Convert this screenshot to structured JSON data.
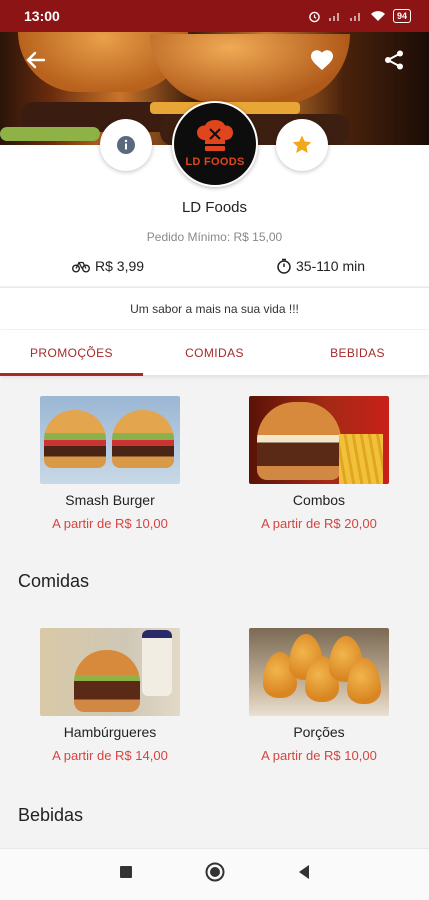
{
  "status_bar": {
    "time": "13:00",
    "battery": "94"
  },
  "colors": {
    "brand": "#8c1414",
    "accent": "#a52a2a",
    "price": "#d64541",
    "favorite_star": "#f0a818"
  },
  "header": {
    "back_icon": "arrow-left-icon",
    "favorite_icon": "heart-icon",
    "share_icon": "share-icon",
    "info_icon": "info-icon",
    "rate_icon": "star-icon",
    "logo_text": "LD FOODS"
  },
  "store": {
    "name": "LD Foods",
    "min_order": "Pedido Mínimo: R$ 15,00",
    "delivery_fee": "R$ 3,99",
    "delivery_time": "35-110 min",
    "slogan": "Um sabor a mais na sua vida !!!"
  },
  "tabs": [
    {
      "label": "PROMOÇÕES",
      "active": true
    },
    {
      "label": "COMIDAS",
      "active": false
    },
    {
      "label": "BEBIDAS",
      "active": false
    }
  ],
  "promotions": [
    {
      "name": "Smash Burger",
      "price": "A partir de R$ 10,00"
    },
    {
      "name": "Combos",
      "price": "A partir de R$ 20,00"
    }
  ],
  "foods": {
    "title": "Comidas",
    "items": [
      {
        "name": "Hambúrgueres",
        "price": "A partir de R$ 14,00"
      },
      {
        "name": "Porções",
        "price": "A partir de R$ 10,00"
      }
    ]
  },
  "drinks": {
    "title": "Bebidas"
  }
}
